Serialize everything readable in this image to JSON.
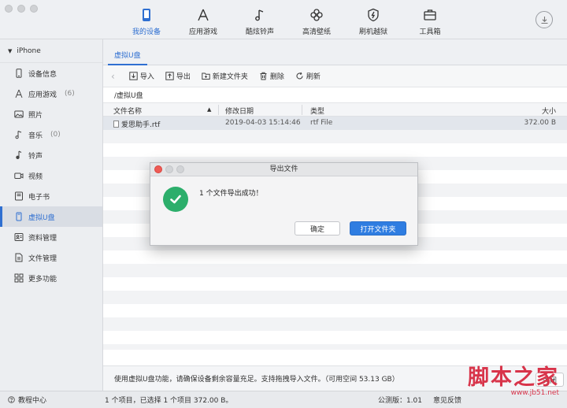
{
  "nav": {
    "items": [
      {
        "label": "我的设备",
        "icon": "phone-icon"
      },
      {
        "label": "应用游戏",
        "icon": "appstore-icon"
      },
      {
        "label": "酷炫铃声",
        "icon": "music-note-icon"
      },
      {
        "label": "高清壁纸",
        "icon": "flower-icon"
      },
      {
        "label": "刷机越狱",
        "icon": "shield-icon"
      },
      {
        "label": "工具箱",
        "icon": "toolbox-icon"
      }
    ],
    "active_index": 0
  },
  "sidebar": {
    "device": "iPhone",
    "items": [
      {
        "label": "设备信息",
        "count": "",
        "icon": "device-info-icon"
      },
      {
        "label": "应用游戏",
        "count": "(6)",
        "icon": "appstore-icon"
      },
      {
        "label": "照片",
        "count": "",
        "icon": "photo-icon"
      },
      {
        "label": "音乐",
        "count": "(0)",
        "icon": "music-icon"
      },
      {
        "label": "铃声",
        "count": "",
        "icon": "ringtone-icon"
      },
      {
        "label": "视频",
        "count": "",
        "icon": "video-icon"
      },
      {
        "label": "电子书",
        "count": "",
        "icon": "ebook-icon"
      },
      {
        "label": "虚拟U盘",
        "count": "",
        "icon": "usb-disk-icon"
      },
      {
        "label": "资料管理",
        "count": "",
        "icon": "contacts-icon"
      },
      {
        "label": "文件管理",
        "count": "",
        "icon": "file-manager-icon"
      },
      {
        "label": "更多功能",
        "count": "",
        "icon": "grid-icon"
      }
    ],
    "active_index": 7
  },
  "main": {
    "tab": "虚拟U盘",
    "toolbar": {
      "import": "导入",
      "export": "导出",
      "new_folder": "新建文件夹",
      "delete": "删除",
      "refresh": "刷新"
    },
    "path": "/虚拟U盘",
    "columns": {
      "name": "文件名称",
      "date": "修改日期",
      "type": "类型",
      "size": "大小"
    },
    "files": [
      {
        "name": "爱思助手.rtf",
        "date": "2019-04-03 15:14:46",
        "type": "rtf File",
        "size": "372.00 B"
      }
    ],
    "footer_note": "使用虚拟U盘功能，请确保设备剩余容量充足。支持拖拽导入文件。（可用空间 53.13 GB）",
    "close_label": "关闭"
  },
  "status": {
    "help": "教程中心",
    "selection": "1 个项目，已选择 1 个项目 372.00 B。",
    "version": "公测版：1.01",
    "feedback": "意见反馈"
  },
  "dialog": {
    "title": "导出文件",
    "message": "1 个文件导出成功！",
    "ok_label": "确定",
    "open_label": "打开文件夹"
  },
  "watermark": {
    "text": "脚本之家",
    "url": "www.jb51.net"
  },
  "colors": {
    "accent": "#2f6fd1",
    "success": "#2cae6b",
    "primary_button": "#2f7de1",
    "watermark": "#d8344a"
  }
}
